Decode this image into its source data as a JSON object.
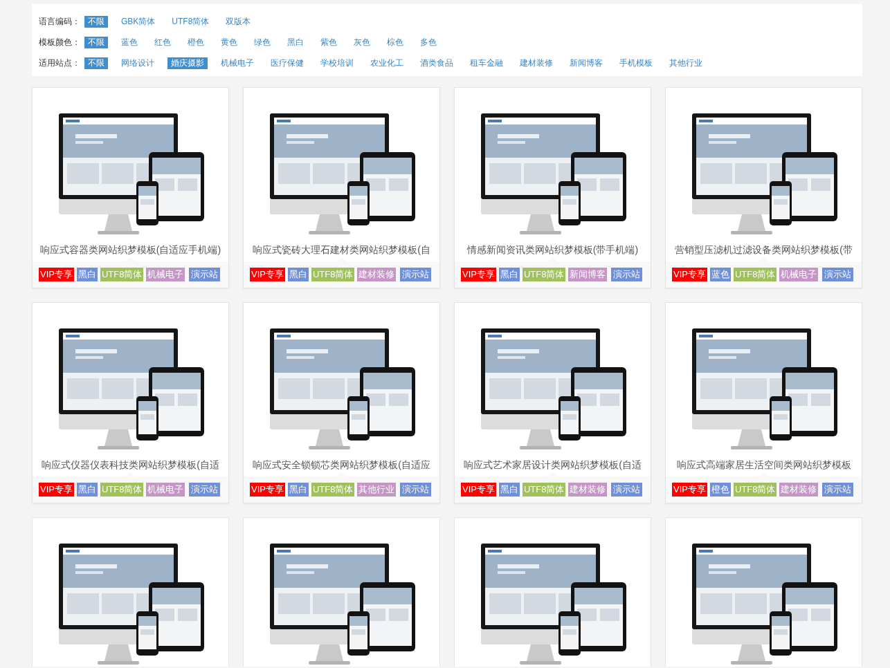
{
  "filters": [
    {
      "label": "语言编码：",
      "options": [
        {
          "text": "不限",
          "selected": true
        },
        {
          "text": "GBK简体",
          "selected": false
        },
        {
          "text": "UTF8简体",
          "selected": false
        },
        {
          "text": "双版本",
          "selected": false
        }
      ]
    },
    {
      "label": "模板颜色：",
      "options": [
        {
          "text": "不限",
          "selected": true
        },
        {
          "text": "蓝色",
          "selected": false
        },
        {
          "text": "红色",
          "selected": false
        },
        {
          "text": "橙色",
          "selected": false
        },
        {
          "text": "黄色",
          "selected": false
        },
        {
          "text": "绿色",
          "selected": false
        },
        {
          "text": "黑白",
          "selected": false
        },
        {
          "text": "紫色",
          "selected": false
        },
        {
          "text": "灰色",
          "selected": false
        },
        {
          "text": "棕色",
          "selected": false
        },
        {
          "text": "多色",
          "selected": false
        }
      ]
    },
    {
      "label": "适用站点：",
      "options": [
        {
          "text": "不限",
          "selected": true
        },
        {
          "text": "网络设计",
          "selected": false
        },
        {
          "text": "婚庆摄影",
          "selected": true
        },
        {
          "text": "机械电子",
          "selected": false
        },
        {
          "text": "医疗保健",
          "selected": false
        },
        {
          "text": "学校培训",
          "selected": false
        },
        {
          "text": "农业化工",
          "selected": false
        },
        {
          "text": "酒类食品",
          "selected": false
        },
        {
          "text": "租车金融",
          "selected": false
        },
        {
          "text": "建材装修",
          "selected": false
        },
        {
          "text": "新闻博客",
          "selected": false
        },
        {
          "text": "手机模板",
          "selected": false
        },
        {
          "text": "其他行业",
          "selected": false
        }
      ]
    }
  ],
  "templates": [
    {
      "kind": "card",
      "title": "响应式容器类网站织梦模板(自适应手机端)",
      "tags": [
        {
          "text": "VIP专享",
          "kind": "vip"
        },
        {
          "text": "黑白",
          "kind": "palette"
        },
        {
          "text": "UTF8简体",
          "kind": "encoding"
        },
        {
          "text": "机械电子",
          "kind": "industry"
        }
      ],
      "demo_link": "演示站"
    },
    {
      "kind": "card",
      "title": "响应式瓷砖大理石建材类网站织梦模板(自",
      "tags": [
        {
          "text": "VIP专享",
          "kind": "vip"
        },
        {
          "text": "黑白",
          "kind": "palette"
        },
        {
          "text": "UTF8简体",
          "kind": "encoding"
        },
        {
          "text": "建材装修",
          "kind": "industry"
        }
      ],
      "demo_link": "演示站"
    },
    {
      "kind": "card",
      "title": "情感新闻资讯类网站织梦模板(带手机端)",
      "tags": [
        {
          "text": "VIP专享",
          "kind": "vip"
        },
        {
          "text": "黑白",
          "kind": "palette"
        },
        {
          "text": "UTF8简体",
          "kind": "encoding"
        },
        {
          "text": "新闻博客",
          "kind": "industry"
        }
      ],
      "demo_link": "演示站"
    },
    {
      "kind": "card",
      "title": "营销型压滤机过滤设备类网站织梦模板(带",
      "tags": [
        {
          "text": "VIP专享",
          "kind": "vip"
        },
        {
          "text": "蓝色",
          "kind": "palette"
        },
        {
          "text": "UTF8简体",
          "kind": "encoding"
        },
        {
          "text": "机械电子",
          "kind": "industry"
        }
      ],
      "demo_link": "演示站"
    },
    {
      "kind": "card",
      "title": "响应式仪器仪表科技类网站织梦模板(自适",
      "tags": [
        {
          "text": "VIP专享",
          "kind": "vip"
        },
        {
          "text": "黑白",
          "kind": "palette"
        },
        {
          "text": "UTF8简体",
          "kind": "encoding"
        },
        {
          "text": "机械电子",
          "kind": "industry"
        }
      ],
      "demo_link": "演示站"
    },
    {
      "kind": "card",
      "title": "响应式安全锁锁芯类网站织梦模板(自适应",
      "tags": [
        {
          "text": "VIP专享",
          "kind": "vip"
        },
        {
          "text": "黑白",
          "kind": "palette"
        },
        {
          "text": "UTF8简体",
          "kind": "encoding"
        },
        {
          "text": "其他行业",
          "kind": "industry"
        }
      ],
      "demo_link": "演示站"
    },
    {
      "kind": "card",
      "title": "响应式艺术家居设计类网站织梦模板(自适",
      "tags": [
        {
          "text": "VIP专享",
          "kind": "vip"
        },
        {
          "text": "黑白",
          "kind": "palette"
        },
        {
          "text": "UTF8简体",
          "kind": "encoding"
        },
        {
          "text": "建材装修",
          "kind": "industry"
        }
      ],
      "demo_link": "演示站"
    },
    {
      "kind": "card",
      "title": "响应式高端家居生活空间类网站织梦模板",
      "tags": [
        {
          "text": "VIP专享",
          "kind": "vip"
        },
        {
          "text": "橙色",
          "kind": "palette"
        },
        {
          "text": "UTF8简体",
          "kind": "encoding"
        },
        {
          "text": "建材装修",
          "kind": "industry"
        }
      ],
      "demo_link": "演示站"
    },
    {
      "kind": "preview_only"
    },
    {
      "kind": "preview_only"
    },
    {
      "kind": "preview_only"
    },
    {
      "kind": "preview_only"
    }
  ]
}
